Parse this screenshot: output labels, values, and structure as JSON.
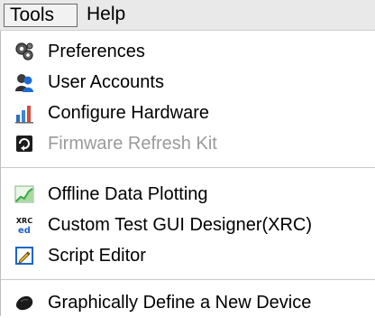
{
  "menubar": {
    "tools_label": "Tools",
    "help_label": "Help"
  },
  "tools_menu": {
    "items": [
      {
        "label": "Preferences",
        "icon": "preferences-gears-icon",
        "enabled": true
      },
      {
        "label": "User Accounts",
        "icon": "user-accounts-icon",
        "enabled": true
      },
      {
        "label": "Configure Hardware",
        "icon": "configure-hardware-icon",
        "enabled": true
      },
      {
        "label": "Firmware Refresh Kit",
        "icon": "firmware-refresh-icon",
        "enabled": false
      },
      {
        "label": "Offline Data Plotting",
        "icon": "data-plot-icon",
        "enabled": true
      },
      {
        "label": "Custom Test GUI Designer(XRC)",
        "icon": "xrc-ed-icon",
        "icon_text_top": "XRC",
        "icon_text_bottom": "ed",
        "enabled": true
      },
      {
        "label": "Script Editor",
        "icon": "script-editor-icon",
        "enabled": true
      },
      {
        "label": "Graphically Define a New Device",
        "icon": "define-device-icon",
        "enabled": true
      }
    ]
  },
  "colors": {
    "menubar_bg": "#e9e9e9",
    "menu_bg": "#ffffff",
    "disabled_text": "#9a9a9a",
    "separator": "#c8c8c8"
  }
}
